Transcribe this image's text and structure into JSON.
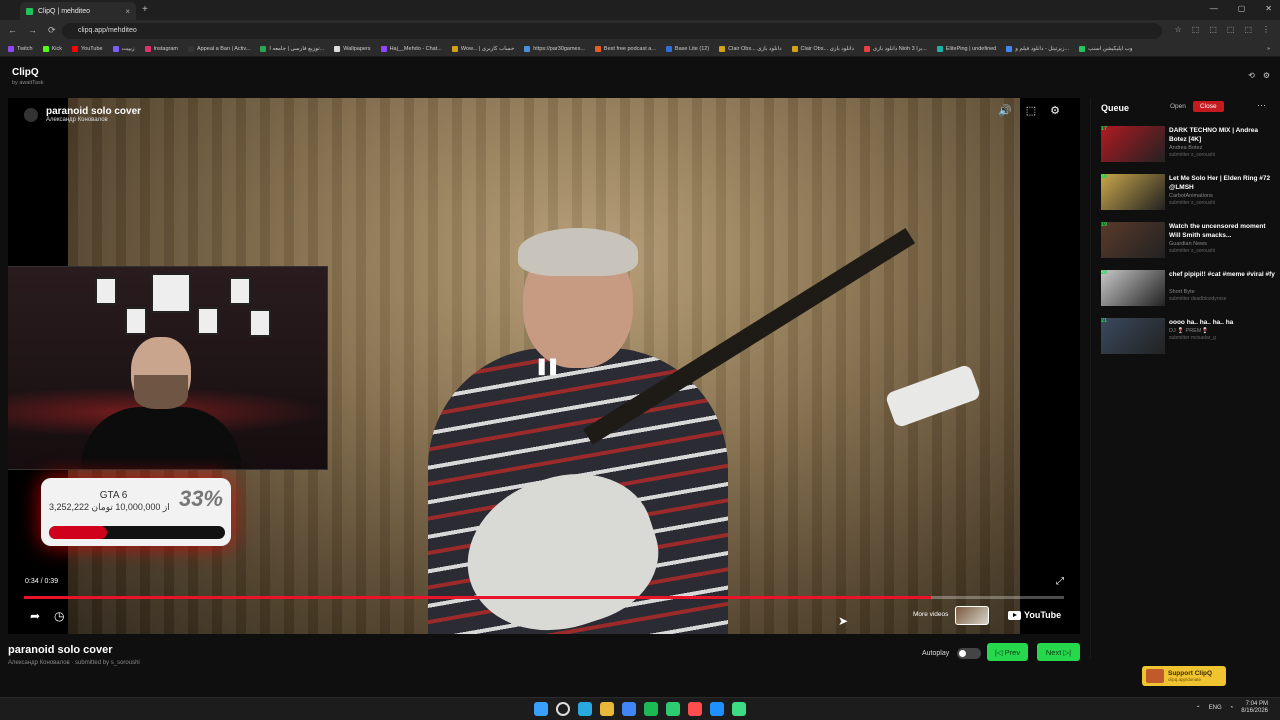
{
  "browser": {
    "tab_title": "ClipQ | mehditeo",
    "tab_close": "×",
    "new_tab": "+",
    "url": "clipq.app/mehditeo",
    "window_buttons": [
      "—",
      "▢",
      "✕"
    ],
    "nav": [
      "←",
      "→",
      "⟳"
    ],
    "addr_icons": [
      "☆",
      "⬚",
      "⬚",
      "⬚",
      "⬚",
      "⋮"
    ],
    "bookmarks": [
      {
        "label": "Twitch",
        "color": "#9146ff"
      },
      {
        "label": "Kick",
        "color": "#53fc18"
      },
      {
        "label": "YouTube",
        "color": "#ff0000"
      },
      {
        "label": "زیپیت",
        "color": "#7c5cff"
      },
      {
        "label": "Instagram",
        "color": "#e1306c"
      },
      {
        "label": "Appeal a Ban | Activ...",
        "color": "#333333"
      },
      {
        "label": "توزیع فارسی | جامعه ا...",
        "color": "#2aa84f"
      },
      {
        "label": "Wallpapers",
        "color": "#dddddd"
      },
      {
        "label": "Haj__Mehdo - Chat...",
        "color": "#9146ff"
      },
      {
        "label": "Wow... | حساب کاربری",
        "color": "#d4a017"
      },
      {
        "label": "https://par30games...",
        "color": "#4a90d9"
      },
      {
        "label": "Best free podcast a...",
        "color": "#e85d1f"
      },
      {
        "label": "Base Lite (12)",
        "color": "#2f6fd9"
      },
      {
        "label": "Clair Obs... دانلود بازی",
        "color": "#d4a017"
      },
      {
        "label": "Clair Obs... دانلود بازی",
        "color": "#d4a017"
      },
      {
        "label": "دانلود بازی Nioh 3 برا...",
        "color": "#e84040"
      },
      {
        "label": "ElitePing | undefined",
        "color": "#1fb1a8"
      },
      {
        "label": "زیرتیتل - دانلود فیلم و...",
        "color": "#4285f4"
      },
      {
        "label": "وب اپلیکیشن اسنپ",
        "color": "#22c55e"
      }
    ],
    "bookmarks_more": "»"
  },
  "app": {
    "brand": "ClipQ",
    "brand_sub": "by awaitTask",
    "head_icons": [
      "⟲",
      "⚙"
    ]
  },
  "player": {
    "video_title": "paranoid solo cover",
    "video_channel": "Александр Коновалов",
    "tool_icons": [
      "🔊",
      "⬚",
      "⚙"
    ],
    "pause_glyph": "❚❚",
    "time": "0:34 / 0:39",
    "progress": 0.872,
    "expand_glyph": "⤢",
    "share_glyph": "➦",
    "watch_glyph": "◷",
    "more_videos": "More videos",
    "youtube": "YouTube"
  },
  "donation": {
    "title": "GTA 6",
    "amount_text": "3,252,222 از 10,000,000 تومان",
    "percent": "33%",
    "fill": 0.33,
    "bar_color": "#d0021b"
  },
  "now_playing": {
    "title": "paranoid solo cover",
    "subtitle": "Александр Коновалов · submitted by s_soroushi"
  },
  "controls": {
    "autoplay": "Autoplay",
    "prev": "|◁ Prev",
    "next": "Next ▷|"
  },
  "queue": {
    "title": "Queue",
    "open": "Open",
    "close": "Close",
    "more": "⋯",
    "items": [
      {
        "num": "17",
        "title": "DARK TECHNO MIX | Andrea Botez [4K]",
        "channel": "Andrea Botez",
        "submitter": "submitter s_soroushi",
        "thumb": "#b01a22"
      },
      {
        "num": "18",
        "title": "Let Me Solo Her | Elden Ring #72 @LMSH",
        "channel": "CarbotAnimations",
        "submitter": "submitter s_soroushi",
        "thumb": "#c9a64a"
      },
      {
        "num": "19",
        "title": "Watch the uncensored moment Will Smith smacks...",
        "channel": "Guardian News",
        "submitter": "submitter s_soroushi",
        "thumb": "#5a3a2a"
      },
      {
        "num": "20",
        "title": "chef pipipi!! #cat #meme #viral #fy",
        "channel": "Short Byte",
        "submitter": "submitter deadbloodyrose",
        "thumb": "#c8c8c8"
      },
      {
        "num": "21",
        "title": "oooo ha.. ha.. ha.. ha",
        "channel": "DJ 🍷 PREM🍷",
        "submitter": "submitter mosadar_g",
        "thumb": "#3a4a5e"
      }
    ]
  },
  "support": {
    "label": "Support ClipQ",
    "sub": "clipq.app/donate"
  },
  "taskbar": {
    "tray_lang": "ENG",
    "time": "7:04 PM",
    "date": "8/16/2026",
    "app_colors": [
      "#3aa0ff",
      "#ffffff",
      "#2aa8e0",
      "#e8b83a",
      "#4285f4",
      "#1db954",
      "#2ecc71",
      "#ff4d4d",
      "#1e90ff",
      "#3ddc84"
    ]
  }
}
